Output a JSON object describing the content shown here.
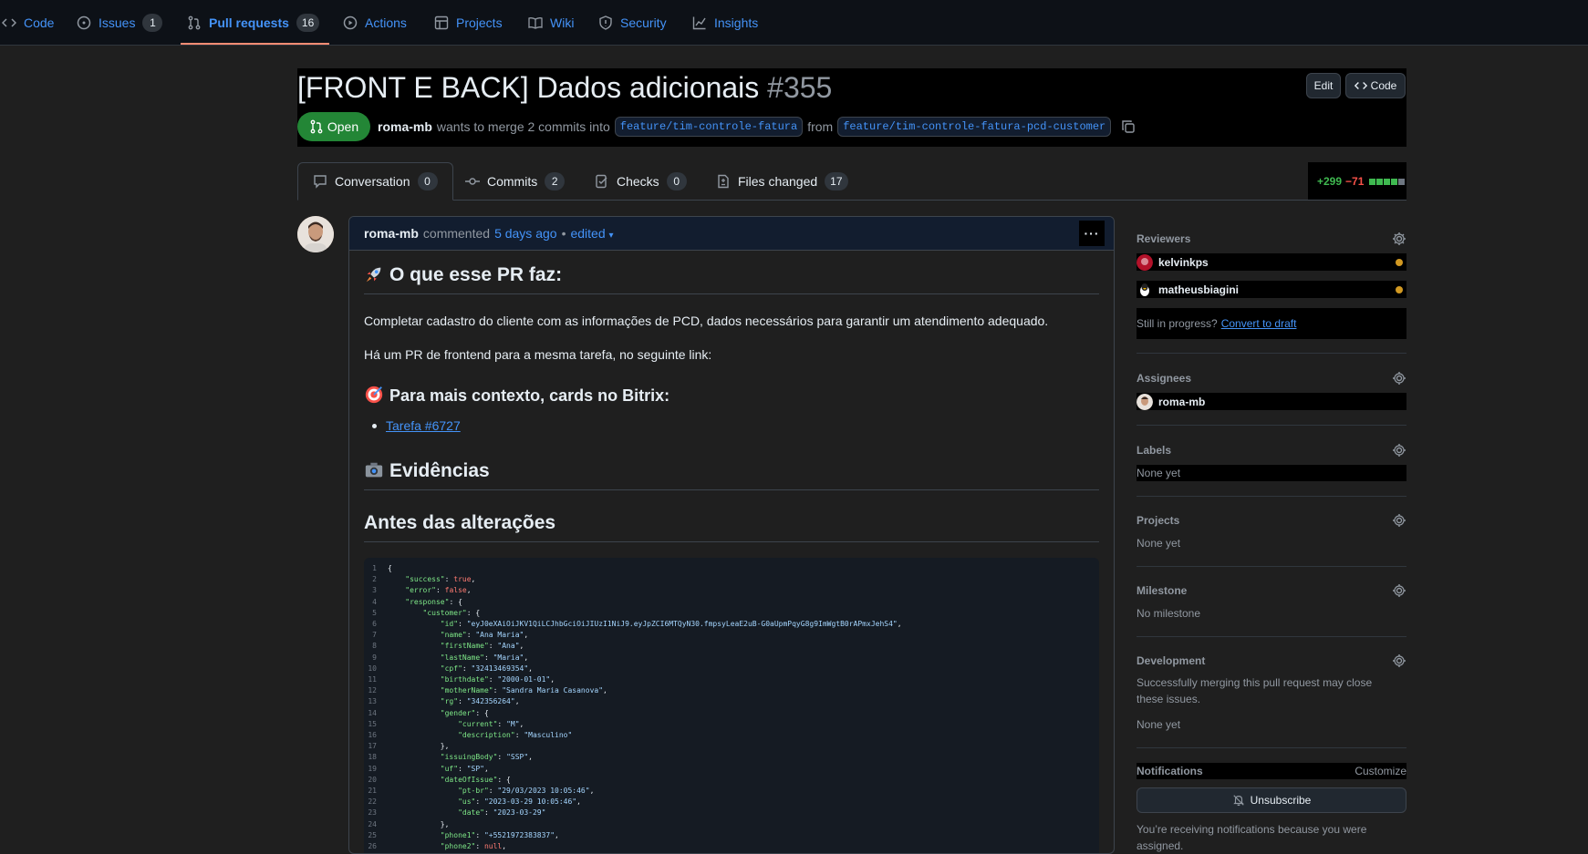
{
  "topnav": {
    "items": [
      {
        "label": "Code",
        "icon": "code-icon"
      },
      {
        "label": "Issues",
        "icon": "issue-icon",
        "count": "1"
      },
      {
        "label": "Pull requests",
        "icon": "pull-request-icon",
        "count": "16"
      },
      {
        "label": "Actions",
        "icon": "play-icon"
      },
      {
        "label": "Projects",
        "icon": "table-icon"
      },
      {
        "label": "Wiki",
        "icon": "book-icon"
      },
      {
        "label": "Security",
        "icon": "shield-icon"
      },
      {
        "label": "Insights",
        "icon": "graph-icon"
      }
    ]
  },
  "pr": {
    "title": "[FRONT E BACK] Dados adicionais",
    "number": "#355",
    "edit_label": "Edit",
    "code_label": "Code",
    "state": "Open",
    "author": "roma-mb",
    "merge_text": "wants to merge 2 commits into",
    "base_branch": "feature/tim-controle-fatura",
    "from_text": "from",
    "head_branch": "feature/tim-controle-fatura-pcd-customer"
  },
  "tabs": [
    {
      "label": "Conversation",
      "count": "0"
    },
    {
      "label": "Commits",
      "count": "2"
    },
    {
      "label": "Checks",
      "count": "0"
    },
    {
      "label": "Files changed",
      "count": "17"
    }
  ],
  "diffstat": {
    "additions": "+299",
    "deletions": "−71"
  },
  "comment": {
    "author": "roma-mb",
    "action": "commented",
    "time": "5 days ago",
    "separator": "•",
    "edited": "edited",
    "heading1": "O que esse PR faz:",
    "para1": "Completar cadastro do cliente com as informações de PCD, dados necessários para garantir um atendimento adequado.",
    "para2": "Há um PR de frontend para a mesma tarefa, no seguinte link:",
    "heading2": "Para mais contexto, cards no Bitrix:",
    "link": "Tarefa #6727",
    "heading3": "Evidências",
    "heading4": "Antes das alterações"
  },
  "code_lines": [
    "{",
    "    \"success\": true,",
    "    \"error\": false,",
    "    \"response\": {",
    "        \"customer\": {",
    "            \"id\": \"eyJ0eXAiOiJKV1QiLCJhbGciOiJIUzI1NiJ9.eyJpZCI6MTQyN30.fmpsyLeaE2uB-G0aUpmPqyG8g9ImWgtB0rAPmxJehS4\",",
    "            \"name\": \"Ana Maria\",",
    "            \"firstName\": \"Ana\",",
    "            \"lastName\": \"Maria\",",
    "            \"cpf\": \"32413469354\",",
    "            \"birthdate\": \"2000-01-01\",",
    "            \"motherName\": \"Sandra Maria Casanova\",",
    "            \"rg\": \"342356264\",",
    "            \"gender\": {",
    "                \"current\": \"M\",",
    "                \"description\": \"Masculino\"",
    "            },",
    "            \"issuingBody\": \"SSP\",",
    "            \"uf\": \"SP\",",
    "            \"dateOfIssue\": {",
    "                \"pt-br\": \"29/03/2023 10:05:46\",",
    "                \"us\": \"2023-03-29 10:05:46\",",
    "                \"date\": \"2023-03-29\"",
    "            },",
    "            \"phone1\": \"+5521972383837\",",
    "            \"phone2\": null,"
  ],
  "sidebar": {
    "reviewers_title": "Reviewers",
    "reviewers": [
      "kelvinkps",
      "matheusbiagini"
    ],
    "draft_prefix": "Still in progress?",
    "draft_link": "Convert to draft",
    "assignees_title": "Assignees",
    "assignee": "roma-mb",
    "labels_title": "Labels",
    "labels_value": "None yet",
    "projects_title": "Projects",
    "projects_value": "None yet",
    "milestone_title": "Milestone",
    "milestone_value": "No milestone",
    "development_title": "Development",
    "development_text": "Successfully merging this pull request may close these issues.",
    "development_value": "None yet",
    "notifications_title": "Notifications",
    "customize": "Customize",
    "unsubscribe": "Unsubscribe",
    "notif_text": "You’re receiving notifications because you were assigned."
  },
  "colors": {
    "accent": "#4493f8",
    "open_green": "#238636",
    "tab_underline": "#fd8c73",
    "pending": "#d29922"
  }
}
